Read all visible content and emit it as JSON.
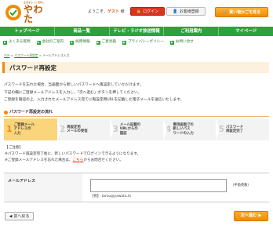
{
  "header": {
    "logo_tagline": "生活をもっと便利に",
    "logo_name": "やわた",
    "welcome_prefix": "ようこそ、",
    "welcome_guest": "ゲスト",
    "welcome_suffix": " 様",
    "login_label": "ログイン",
    "register_label": "お客様登録",
    "cart_label": "買い物かごを見る"
  },
  "nav": {
    "items": [
      "トップページ",
      "商品一覧",
      "テレビ・ラジオ放送情報",
      "ご利用案内",
      "マイページ"
    ]
  },
  "subnav": {
    "items": [
      "よくある質問",
      "会社のご案内",
      "採用情報",
      "ご意見箱",
      "プライバシーポリシー",
      "お問い合せ"
    ]
  },
  "breadcrumb": {
    "home": "TOP",
    "mid": "パスワード再設定",
    "current": "メールアドレス入力"
  },
  "page": {
    "title": "パスワード再設定",
    "intro_lines": [
      "パスワードを忘れた場合、当画面から新しいパスワードへ再設定していただけます。",
      "下記の欄にご登録メールアドレスを入力し、「次へ進む」ボタンを押してください。",
      "ご登録を確認の上、入力されたメールアドレス宛てに再設定用URLを記載した電子メールを送信いたします。"
    ],
    "section_title": "パスワード再設定の流れ"
  },
  "steps": [
    {
      "num": "1",
      "label": "ご登録メール\nアドレスの\n入力"
    },
    {
      "num": "2",
      "label": "再設定用\nメールの受信"
    },
    {
      "num": "3",
      "label": "メール記載の\nURLからの\n認証"
    },
    {
      "num": "4",
      "label": "専用画面での\n新しいパス\nワードの入力"
    },
    {
      "num": "5",
      "label": "パスワード\n再設定完了"
    }
  ],
  "notes": {
    "heading": "【ご注意】",
    "line1": "※パスワード再設定完了後に、新しいパスワードでログインできるようになります。",
    "line2_prefix": "※ご登録メールアドレスを忘れた場合は、",
    "line2_link": "こちら",
    "line2_suffix": "からお問合せください。"
  },
  "form": {
    "email_label": "メールアドレス",
    "email_value": "",
    "email_hint": "（半角英数）",
    "example": "【例】 tarou@yawata.tv"
  },
  "actions": {
    "back_label": "前へ戻る",
    "next_label": "次へ進む"
  },
  "colors": {
    "brand_green": "#2aa43a",
    "accent_orange": "#f08c00",
    "login_red": "#d8351f"
  }
}
